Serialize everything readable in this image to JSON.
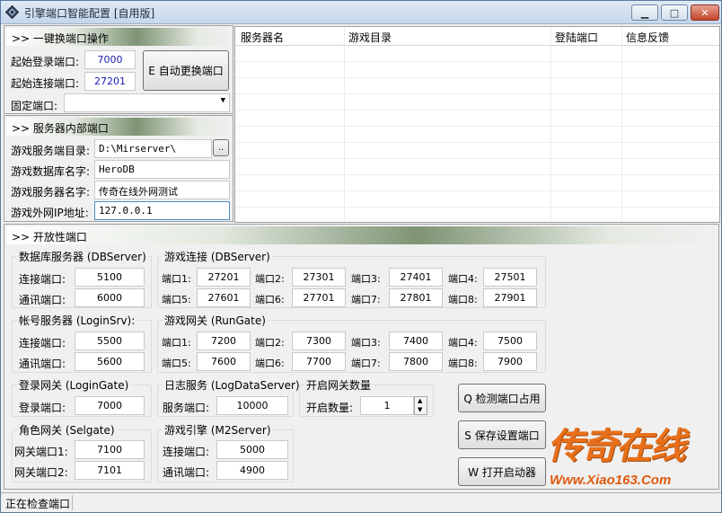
{
  "window": {
    "title": "引擎端口智能配置 [自用版]",
    "buttons": {
      "minimize": "▁",
      "maximize": "□",
      "close": "✕"
    }
  },
  "quick_switch": {
    "header": ">> 一键换端口操作",
    "start_login_label": "起始登录端口:",
    "start_login_value": "7000",
    "start_connect_label": "起始连接端口:",
    "start_connect_value": "27201",
    "auto_button": "E 自动更换端口",
    "fixed_label": "固定端口:",
    "fixed_value": ""
  },
  "internal": {
    "header": ">> 服务器内部端口",
    "dir_label": "游戏服务端目录:",
    "dir_value": "D:\\Mirserver\\",
    "browse_label": "..",
    "db_label": "游戏数据库名字:",
    "db_value": "HeroDB",
    "name_label": "游戏服务器名字:",
    "name_value": "传奇在线外网测试",
    "ip_label": "游戏外网IP地址:",
    "ip_value": "127.0.0.1"
  },
  "server_list": {
    "columns": [
      "服务器名",
      "游戏目录",
      "登陆端口",
      "信息反馈"
    ]
  },
  "open_ports": {
    "header": ">> 开放性端口",
    "dbserver": {
      "title": "数据库服务器 (DBServer)",
      "connect_label": "连接端口:",
      "connect_value": "5100",
      "comm_label": "通讯端口:",
      "comm_value": "6000"
    },
    "loginsrv": {
      "title": "帐号服务器 (LoginSrv):",
      "connect_label": "连接端口:",
      "connect_value": "5500",
      "comm_label": "通讯端口:",
      "comm_value": "5600"
    },
    "logingate": {
      "title": "登录网关 (LoginGate)",
      "login_label": "登录端口:",
      "login_value": "7000"
    },
    "selgate": {
      "title": "角色网关 (Selgate)",
      "gate1_label": "网关端口1:",
      "gate1_value": "7100",
      "gate2_label": "网关端口2:",
      "gate2_value": "7101"
    },
    "db_connect": {
      "title": "游戏连接 (DBServer)",
      "ports": [
        {
          "label": "端口1:",
          "value": "27201"
        },
        {
          "label": "端口2:",
          "value": "27301"
        },
        {
          "label": "端口3:",
          "value": "27401"
        },
        {
          "label": "端口4:",
          "value": "27501"
        },
        {
          "label": "端口5:",
          "value": "27601"
        },
        {
          "label": "端口6:",
          "value": "27701"
        },
        {
          "label": "端口7:",
          "value": "27801"
        },
        {
          "label": "端口8:",
          "value": "27901"
        }
      ]
    },
    "rungate": {
      "title": "游戏网关 (RunGate)",
      "ports": [
        {
          "label": "端口1:",
          "value": "7200"
        },
        {
          "label": "端口2:",
          "value": "7300"
        },
        {
          "label": "端口3:",
          "value": "7400"
        },
        {
          "label": "端口4:",
          "value": "7500"
        },
        {
          "label": "端口5:",
          "value": "7600"
        },
        {
          "label": "端口6:",
          "value": "7700"
        },
        {
          "label": "端口7:",
          "value": "7800"
        },
        {
          "label": "端口8:",
          "value": "7900"
        }
      ]
    },
    "logdata": {
      "title": "日志服务 (LogDataServer)",
      "service_label": "服务端口:",
      "service_value": "10000"
    },
    "gate_count": {
      "title": "开启网关数量",
      "count_label": "开启数量:",
      "count_value": "1"
    },
    "m2server": {
      "title": "游戏引擎 (M2Server)",
      "connect_label": "连接端口:",
      "connect_value": "5000",
      "comm_label": "通讯端口:",
      "comm_value": "4900"
    }
  },
  "actions": {
    "check": "Q 检测端口占用",
    "save": "S 保存设置端口",
    "launcher": "W 打开启动器"
  },
  "watermark": {
    "text": "传奇在线",
    "url": "Www.Xiao163.Com"
  },
  "status_bar": {
    "text": "正在检查端口"
  }
}
